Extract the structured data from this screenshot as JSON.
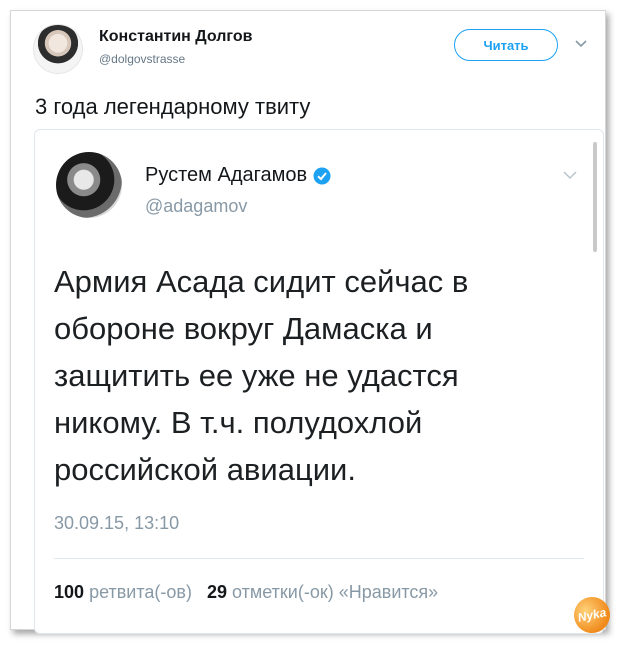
{
  "tweet": {
    "author_name": "Константин Долгов",
    "author_handle": "@dolgovstrasse",
    "follow_label": "Читать",
    "text": "3 года легендарному твиту"
  },
  "quoted": {
    "author_name": "Рустем Адагамов",
    "author_handle": "@adagamov",
    "verified": true,
    "text": "Армия Асада сидит сейчас в обороне вокруг Дамаска и защитить ее уже не удастся никому. В т.ч. полудохлой российской авиации.",
    "timestamp": "30.09.15, 13:10",
    "retweets_count": "100",
    "retweets_label": "ретвита(-ов)",
    "likes_count": "29",
    "likes_label": "отметки(-ок) «Нравится»"
  },
  "watermark": {
    "text": "Nyka"
  },
  "colors": {
    "accent": "#1da1f2",
    "muted": "#8899a6",
    "text": "#14171a"
  },
  "icons": [
    "chevron-down-icon",
    "verified-badge-icon"
  ]
}
